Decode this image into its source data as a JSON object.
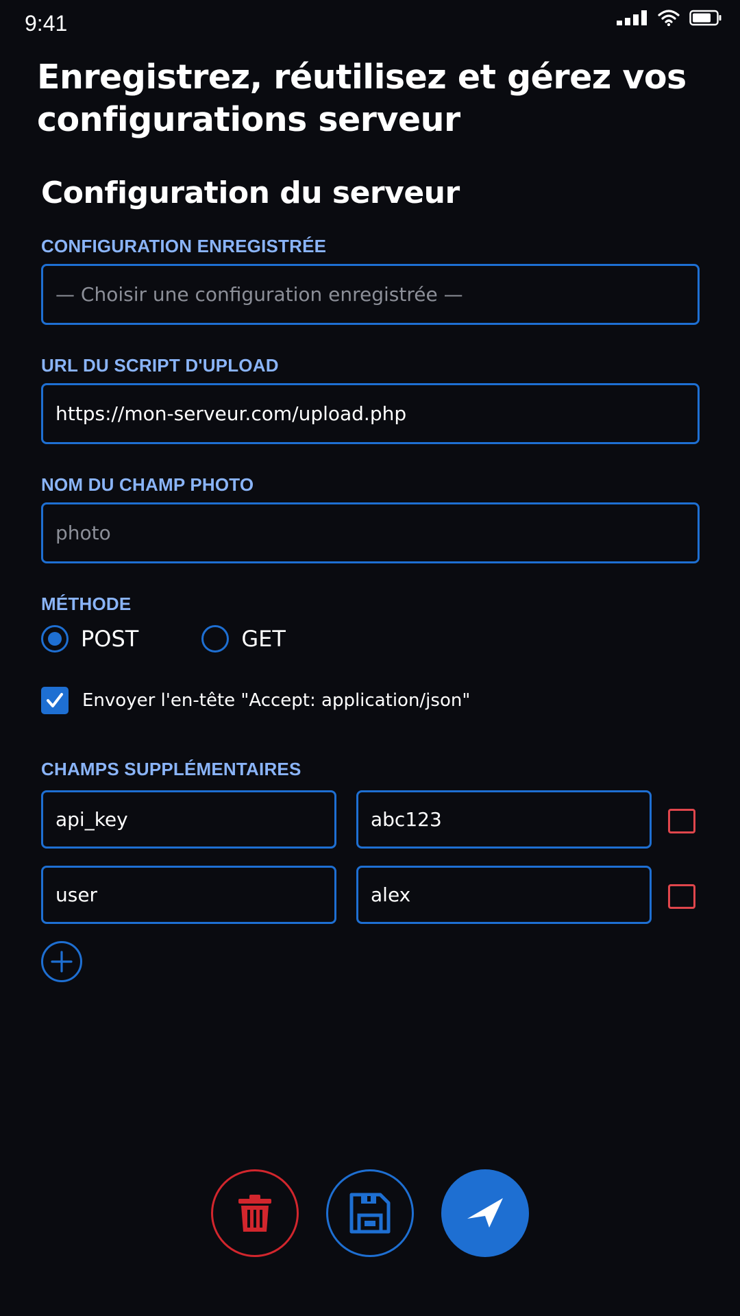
{
  "status_bar": {
    "time": "9:41",
    "icons": [
      "signal-icon",
      "wifi-icon",
      "battery-icon"
    ]
  },
  "headline": "Enregistrez, réutilisez et gérez vos configurations serveur",
  "section_title": "Configuration du serveur",
  "saved_config": {
    "label": "CONFIGURATION ENREGISTRÉE",
    "placeholder": "— Choisir une configuration enregistrée —"
  },
  "upload_url": {
    "label": "URL DU SCRIPT D'UPLOAD",
    "value": "https://mon-serveur.com/upload.php"
  },
  "photo_field": {
    "label": "NOM DU CHAMP PHOTO",
    "placeholder": "photo"
  },
  "method": {
    "label": "MÉTHODE",
    "options": [
      "POST",
      "GET"
    ],
    "selected": "POST"
  },
  "accept_json": {
    "label": "Envoyer l'en-tête \"Accept: application/json\"",
    "checked": true
  },
  "extra_fields": {
    "label": "CHAMPS SUPPLÉMENTAIRES",
    "rows": [
      {
        "key": "api_key",
        "value": "abc123"
      },
      {
        "key": "user",
        "value": "alex"
      }
    ],
    "add_icon": "plus-icon",
    "remove_icon": "remove-row-icon"
  },
  "actions": {
    "delete_icon": "trash-icon",
    "save_icon": "floppy-disk-icon",
    "send_icon": "paper-plane-icon"
  },
  "colors": {
    "background": "#0a0b10",
    "accent": "#1e6fd2",
    "label": "#8ab4f8",
    "danger": "#d2262d"
  }
}
